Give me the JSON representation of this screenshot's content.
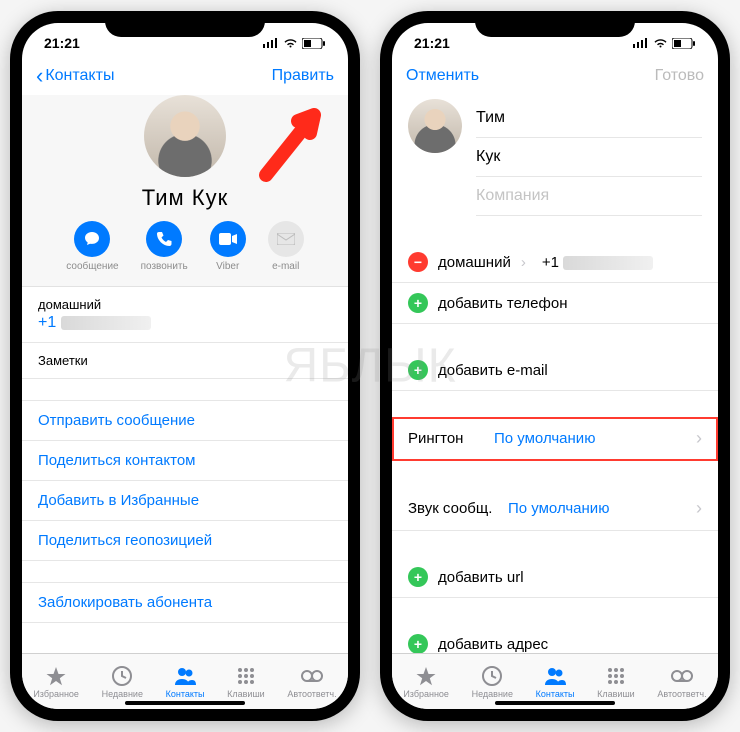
{
  "status": {
    "time": "21:21"
  },
  "left": {
    "nav": {
      "back": "Контакты",
      "edit": "Править"
    },
    "contactName": "Тим  Кук",
    "actions": {
      "message": "сообщение",
      "call": "позвонить",
      "viber": "Viber",
      "email": "e-mail"
    },
    "phone": {
      "label": "домашний",
      "prefix": "+1"
    },
    "notes": "Заметки",
    "links": {
      "sendMessage": "Отправить сообщение",
      "shareContact": "Поделиться контактом",
      "addFavorite": "Добавить в Избранные",
      "shareLocation": "Поделиться геопозицией",
      "block": "Заблокировать абонента"
    }
  },
  "right": {
    "nav": {
      "cancel": "Отменить",
      "done": "Готово"
    },
    "fields": {
      "first": "Тим",
      "last": "Кук",
      "companyPlaceholder": "Компания"
    },
    "phoneRow": {
      "label": "домашний",
      "prefix": "+1"
    },
    "addPhone": "добавить телефон",
    "addEmail": "добавить e-mail",
    "ringtone": {
      "label": "Рингтон",
      "value": "По умолчанию"
    },
    "textTone": {
      "label": "Звук сообщ.",
      "value": "По умолчанию"
    },
    "addUrl": "добавить url",
    "addAddress": "добавить адрес"
  },
  "tabs": {
    "favorites": "Избранное",
    "recents": "Недавние",
    "contacts": "Контакты",
    "keypad": "Клавиши",
    "voicemail": "Автоответч."
  },
  "watermark": "ЯБЛЫК"
}
